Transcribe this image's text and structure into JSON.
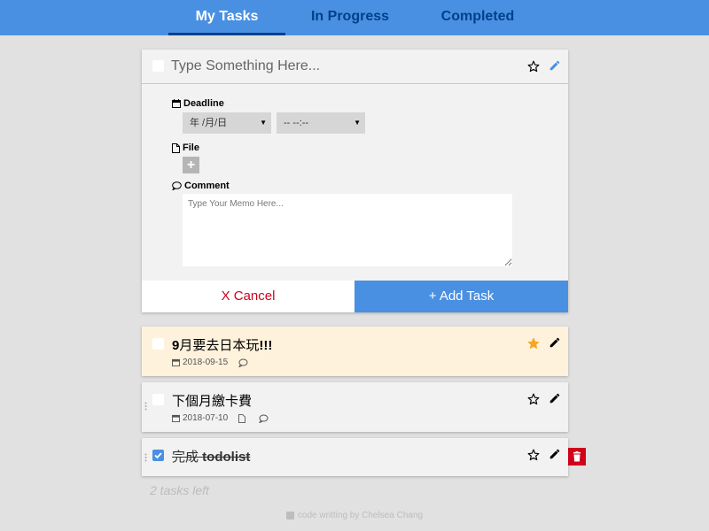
{
  "tabs": [
    {
      "label": "My Tasks"
    },
    {
      "label": "In Progress"
    },
    {
      "label": "Completed"
    }
  ],
  "new_task": {
    "title_placeholder": "Type Something Here...",
    "deadline_label": "Deadline",
    "date_value": "年 /月/日",
    "time_value": "-- --:--",
    "file_label": "File",
    "add_file_symbol": "+",
    "comment_label": "Comment",
    "memo_placeholder": "Type Your Memo Here...",
    "cancel_label": "X Cancel",
    "add_label": "+ Add Task"
  },
  "tasks": [
    {
      "title_prefix": "9",
      "title_middle": "月要去日本玩",
      "title_suffix": "!!!",
      "date": "2018-09-15",
      "starred": true,
      "done": false,
      "icons": [
        "calendar-icon",
        "comment-icon"
      ]
    },
    {
      "title": "下個月繳卡費",
      "date": "2018-07-10",
      "starred": false,
      "done": false,
      "icons": [
        "calendar-icon",
        "file-icon",
        "comment-icon"
      ]
    },
    {
      "title_prefix": "完成 ",
      "title_bold": "todolist",
      "starred": false,
      "done": true
    }
  ],
  "tasks_left": "2 tasks left",
  "footer": "code writting by Chelsea Chang",
  "colors": {
    "header": "#4a90e2",
    "tab_active_underline": "#00408b",
    "star_active": "#f5a623",
    "cancel_text": "#d0021b",
    "delete": "#d0021b",
    "starred_bg": "#fff2dc"
  }
}
